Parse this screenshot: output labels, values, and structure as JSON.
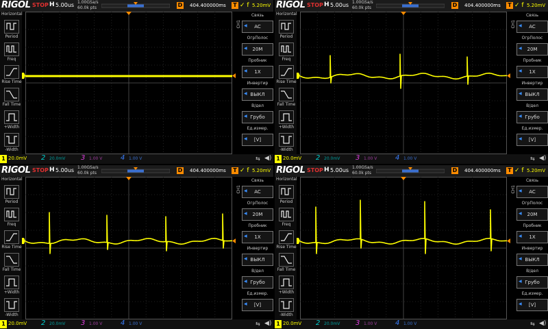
{
  "panels": [
    {
      "offset": "404.400000ms",
      "wave": "flat"
    },
    {
      "offset": "404.400000ms",
      "wave": "spikes_b"
    },
    {
      "offset": "404.400000ms",
      "wave": "spikes_c"
    },
    {
      "offset": "404.400000ms",
      "wave": "spikes_d"
    }
  ],
  "header": {
    "brand": "RIGOL",
    "status": "STOP",
    "h_label": "H",
    "timebase": "5.00us",
    "sample_rate": "1.00GSa/s",
    "points": "60.0k pts",
    "d_label": "D",
    "t_label": "T",
    "trigger_icons": "✓ f",
    "trigger_level": "5.20mV"
  },
  "left_menu": {
    "title": "Horizontal",
    "items": [
      {
        "label": "Period",
        "icon": "period-icon"
      },
      {
        "label": "Freq",
        "icon": "freq-icon"
      },
      {
        "label": "Rise Time",
        "icon": "rise-time-icon"
      },
      {
        "label": "Fall Time",
        "icon": "fall-time-icon"
      },
      {
        "label": "+Width",
        "icon": "plus-width-icon"
      },
      {
        "label": "-Width",
        "icon": "minus-width-icon"
      }
    ]
  },
  "right_menu": {
    "channel_tab": "CH1",
    "items": [
      {
        "title": "Связь",
        "value": "AC"
      },
      {
        "title": "ОгрПолос",
        "value": "20M"
      },
      {
        "title": "Пробник",
        "value": "1X"
      },
      {
        "title": "Инвертир",
        "value": "ВЫКЛ"
      },
      {
        "title": "В/дел",
        "value": "Грубо"
      },
      {
        "title": "Ед.измер.",
        "value": "[V]"
      }
    ]
  },
  "bottom_bar": {
    "ch1_num": "1",
    "ch1_scale": "20.0mV",
    "ch2_num": "2",
    "ch2_scale": "20.0mV",
    "ch3_num": "3",
    "ch3_scale": "1.00 V",
    "ch4_num": "4",
    "ch4_scale": "1.00 V"
  },
  "colors": {
    "ch1": "#ffff00",
    "ch2": "#00d0d0",
    "ch3": "#e040e0",
    "ch4": "#3a7fff",
    "accent": "#ff8c00",
    "stop": "#e03030"
  }
}
